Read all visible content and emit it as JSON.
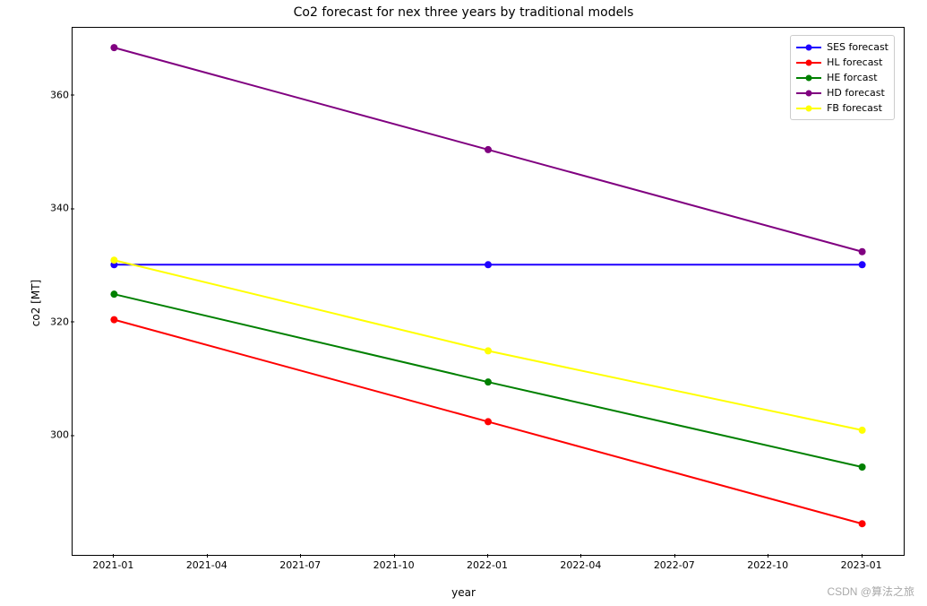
{
  "chart_data": {
    "type": "line",
    "title": "Co2 forecast for nex three years by traditional models",
    "xlabel": "year",
    "ylabel": "co2 [MT]",
    "x_categories": [
      "2021-01",
      "2022-01",
      "2023-01"
    ],
    "x_ticks": [
      "2021-01",
      "2021-04",
      "2021-07",
      "2021-10",
      "2022-01",
      "2022-04",
      "2022-07",
      "2022-10",
      "2023-01"
    ],
    "y_ticks": [
      300,
      320,
      340,
      360
    ],
    "ylim": [
      279,
      372
    ],
    "series": [
      {
        "name": "SES forecast",
        "color": "#1f00ff",
        "values": [
          330.2,
          330.2,
          330.2
        ]
      },
      {
        "name": "HL forecast",
        "color": "#ff0000",
        "values": [
          320.5,
          302.5,
          284.5
        ]
      },
      {
        "name": "HE forcast",
        "color": "#008000",
        "values": [
          325.0,
          309.5,
          294.5
        ]
      },
      {
        "name": "HD forecast",
        "color": "#800080",
        "values": [
          368.5,
          350.5,
          332.5
        ]
      },
      {
        "name": "FB forecast",
        "color": "#ffff00",
        "values": [
          331.0,
          315.0,
          301.0
        ]
      }
    ]
  },
  "watermark": "CSDN @算法之旅"
}
